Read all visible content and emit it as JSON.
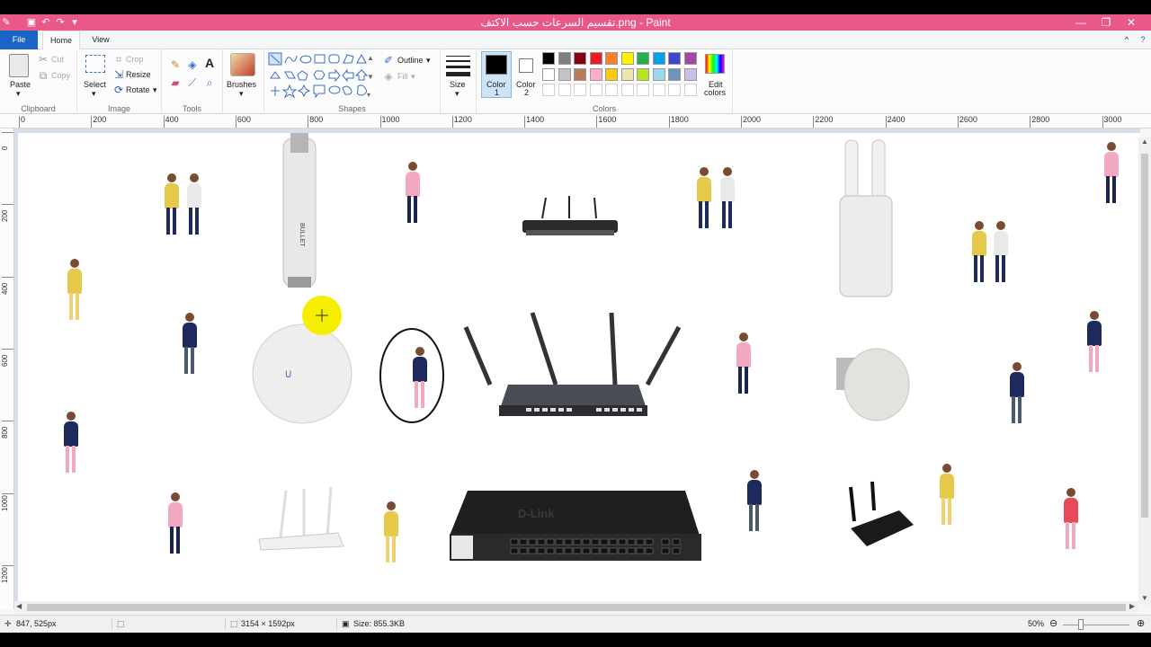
{
  "window": {
    "title": "تقسيم السرعات حسب الاكتف.png - Paint",
    "minimize": "—",
    "maximize": "❐",
    "close": "✕"
  },
  "tabs": {
    "file": "File",
    "home": "Home",
    "view": "View"
  },
  "ribbon": {
    "clipboard": {
      "label": "Clipboard",
      "paste": "Paste",
      "cut": "Cut",
      "copy": "Copy"
    },
    "image": {
      "label": "Image",
      "select": "Select",
      "crop": "Crop",
      "resize": "Resize",
      "rotate": "Rotate"
    },
    "tools": {
      "label": "Tools"
    },
    "brushes": {
      "label": "Brushes"
    },
    "shapes": {
      "label": "Shapes",
      "outline": "Outline",
      "fill": "Fill"
    },
    "size": {
      "label": "Size"
    },
    "colors": {
      "label": "Colors",
      "color1": "Color 1",
      "color1_line1": "Color",
      "color1_line2": "1",
      "color2_line1": "Color",
      "color2_line2": "2",
      "edit_line1": "Edit",
      "edit_line2": "colors",
      "color1_value": "#000000",
      "color2_value": "#ffffff",
      "palette_row1": [
        "#000000",
        "#7f7f7f",
        "#880015",
        "#ed1c24",
        "#ff7f27",
        "#fff200",
        "#22b14c",
        "#00a2e8",
        "#3f48cc",
        "#a349a4"
      ],
      "palette_row2": [
        "#ffffff",
        "#c3c3c3",
        "#b97a57",
        "#ffaec9",
        "#ffc90e",
        "#efe4b0",
        "#b5e61d",
        "#99d9ea",
        "#7092be",
        "#c8bfe7"
      ]
    }
  },
  "ruler": {
    "h": [
      "0",
      "200",
      "400",
      "600",
      "800",
      "1000",
      "1200",
      "1400",
      "1600",
      "1800",
      "2000",
      "2200",
      "2400",
      "2600",
      "2800",
      "3000"
    ],
    "v": [
      "0",
      "200",
      "400",
      "600",
      "800",
      "1000",
      "1200"
    ]
  },
  "canvas": {
    "dlink_logo": "D-Link",
    "bullet_label": "BULLET"
  },
  "status": {
    "cursor_pos": "847, 525px",
    "image_size": "3154 × 1592px",
    "file_size": "Size: 855.3KB",
    "zoom": "50%"
  },
  "accent": "#e8588b"
}
